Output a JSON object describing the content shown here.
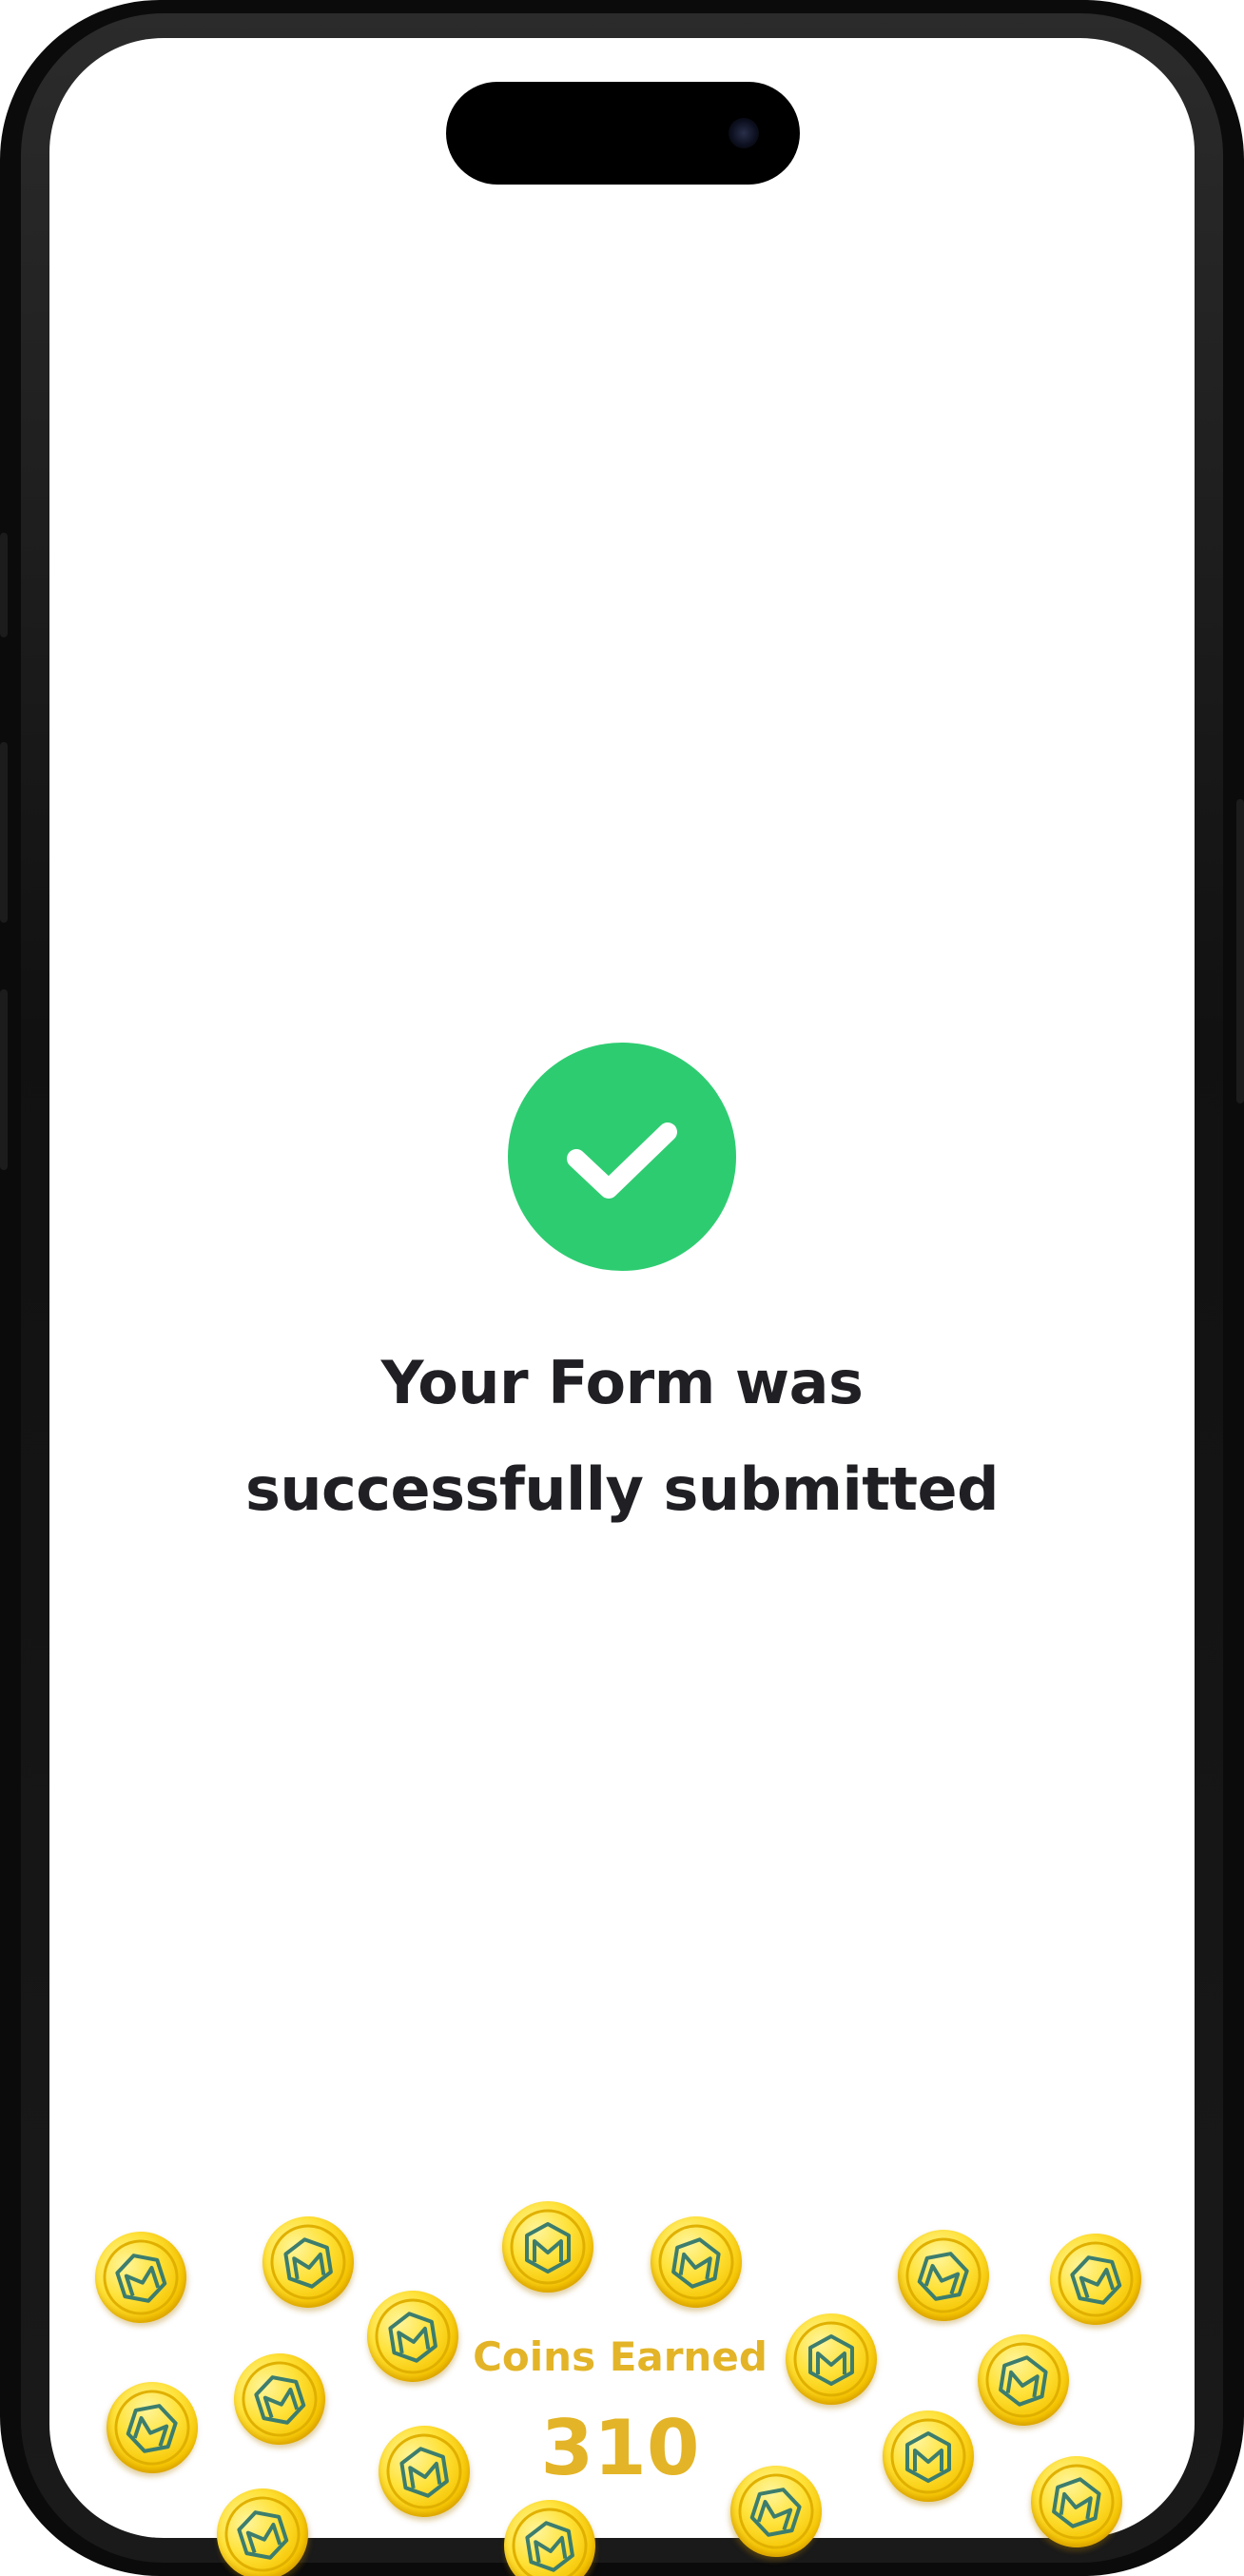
{
  "device": {
    "frame_color": "#0b0b0b",
    "screen_color": "#ffffff"
  },
  "status": {
    "icon": "checkmark-icon",
    "icon_color": "#2ECC71"
  },
  "message": {
    "line1": "Your Form was",
    "line2": "successfully submitted",
    "color": "#1f1f24"
  },
  "reward": {
    "label": "Coins Earned",
    "value": "310",
    "color": "#E3B427",
    "coin_icon": "coin-icon"
  }
}
